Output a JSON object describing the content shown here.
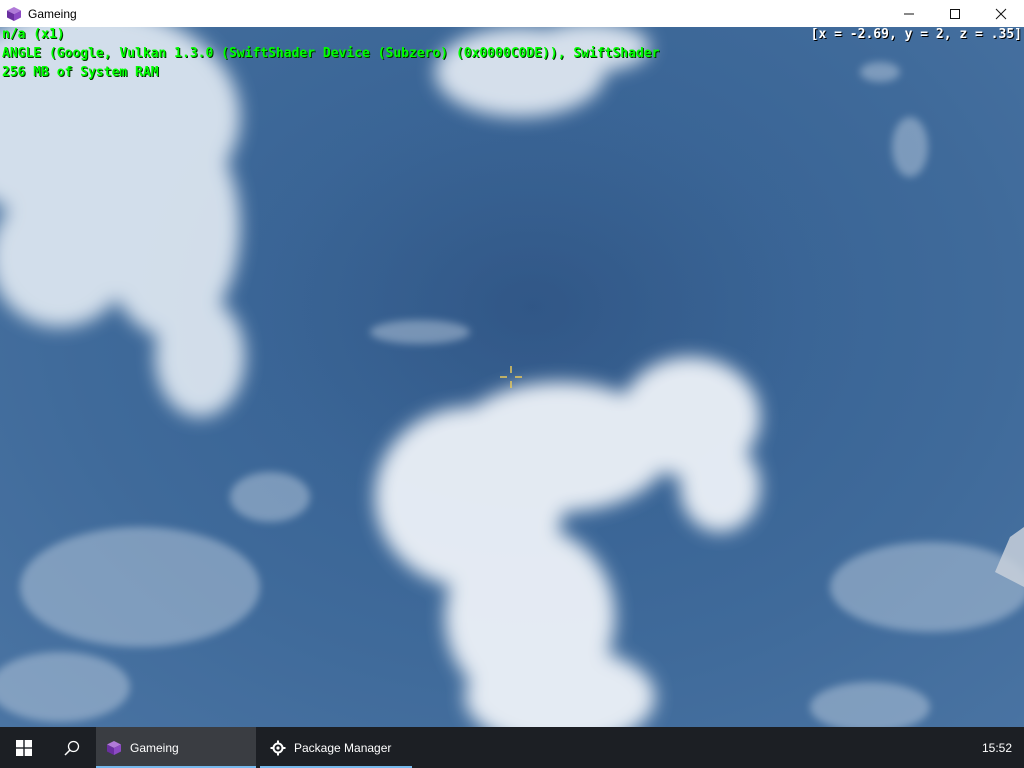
{
  "window": {
    "title": "Gameing",
    "controls": {
      "minimize_icon": "minimize-icon",
      "maximize_icon": "maximize-icon",
      "close_icon": "close-icon"
    }
  },
  "hud": {
    "lines": [
      "n/a (x1)",
      "ANGLE (Google, Vulkan 1.3.0 (SwiftShader Device (Subzero) (0x0000C0DE)), SwiftShader",
      "256 MB of System RAM"
    ],
    "coordinates": "[x = -2.69, y = 2, z = .35]",
    "debug_color": "#00ff00",
    "coord_color": "#ffffff"
  },
  "scene": {
    "description_icon": "cloud-sky-scene",
    "sky_color": "#3c6596",
    "cloud_color": "#e8eef5",
    "crosshair_color": "#e8c85a"
  },
  "taskbar": {
    "start_icon": "windows-start-icon",
    "search_icon": "search-icon",
    "items": [
      {
        "label": "Gameing",
        "icon": "cube-icon",
        "active": true
      },
      {
        "label": "Package Manager",
        "icon": "package-gear-icon",
        "active": false
      }
    ],
    "clock": "15:52",
    "accent_color": "#76b9ed"
  }
}
